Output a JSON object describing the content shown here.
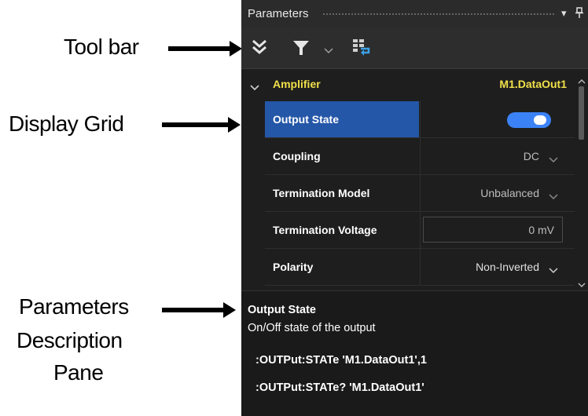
{
  "annotations": {
    "toolbar": "Tool bar",
    "display_grid": "Display Grid",
    "desc_line1": "Parameters",
    "desc_line2": "Description",
    "desc_line3": "Pane"
  },
  "panel": {
    "title": "Parameters",
    "pin_icon": "pin-icon",
    "dropdown_icon": "dropdown-icon"
  },
  "toolbar": {
    "icons": [
      "collapse-all-icon",
      "filter-icon",
      "chevron-down-icon",
      "grid-sync-icon"
    ]
  },
  "grid": {
    "group_name": "Amplifier",
    "group_target": "M1.DataOut1",
    "rows": [
      {
        "name": "Output State",
        "value": "",
        "kind": "toggle",
        "state": "on"
      },
      {
        "name": "Coupling",
        "value": "DC",
        "kind": "dropdown"
      },
      {
        "name": "Termination Model",
        "value": "Unbalanced",
        "kind": "dropdown"
      },
      {
        "name": "Termination Voltage",
        "value": "0 mV",
        "kind": "input"
      },
      {
        "name": "Polarity",
        "value": "Non-Inverted",
        "kind": "dropdown"
      }
    ]
  },
  "description": {
    "title": "Output State",
    "text": "On/Off state of the output",
    "cmd1": ":OUTPut:STATe 'M1.DataOut1',1",
    "cmd2": ":OUTPut:STATe? 'M1.DataOut1'"
  },
  "colors": {
    "accent": "#2557a8",
    "group_yellow": "#f0e04a",
    "toggle": "#3b82f6"
  }
}
